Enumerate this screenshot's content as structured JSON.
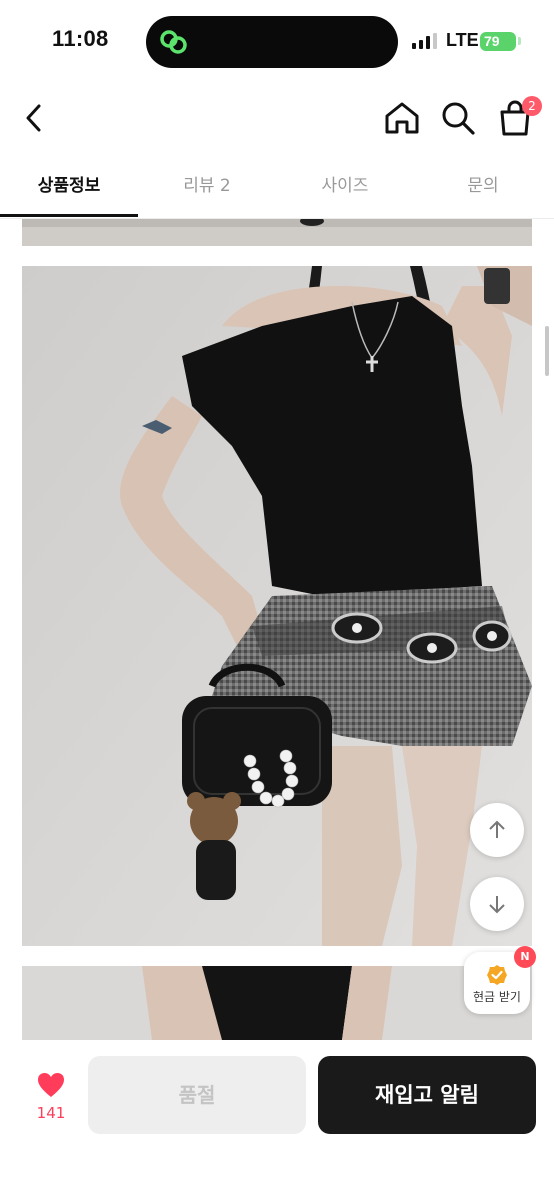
{
  "status_bar": {
    "time": "11:08",
    "network": "LTE",
    "battery": "79"
  },
  "header": {
    "cart_count": "2"
  },
  "tabs": [
    {
      "label": "상품정보",
      "active": true
    },
    {
      "label": "리뷰 2",
      "active": false
    },
    {
      "label": "사이즈",
      "active": false
    },
    {
      "label": "문의",
      "active": false
    }
  ],
  "floating": {
    "cash_label": "현금 받기",
    "cash_badge": "N"
  },
  "bottom_bar": {
    "like_count": "141",
    "soldout_label": "품절",
    "restock_label": "재입고 알림"
  },
  "colors": {
    "accent_red": "#ff3d5a",
    "badge_red": "#ff5a6a",
    "dark_button": "#1a1a1a",
    "battery_green": "#5bd36b"
  },
  "icons": [
    "back-icon",
    "home-icon",
    "search-icon",
    "cart-icon",
    "arrow-up-icon",
    "arrow-down-icon",
    "cash-check-icon",
    "heart-icon"
  ]
}
